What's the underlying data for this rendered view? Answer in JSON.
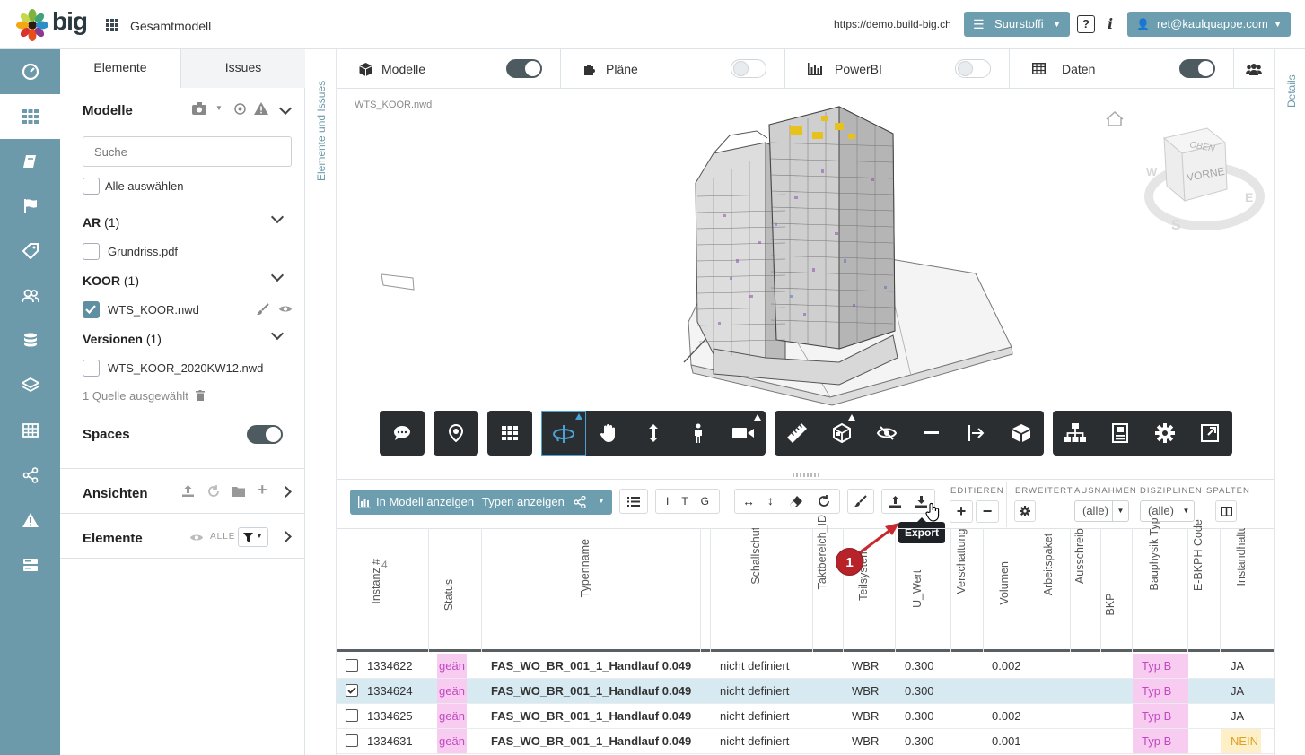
{
  "topbar": {
    "logo_text": "big",
    "project_name": "Gesamtmodell",
    "url": "https://demo.build-big.ch",
    "company_button": "Suurstoffi",
    "help_label": "?",
    "info_label": "i",
    "user_button": "ret@kaulquappe.com"
  },
  "left_panel": {
    "tab_elements": "Elemente",
    "tab_issues": "Issues",
    "models_header": "Modelle",
    "search_placeholder": "Suche",
    "select_all": "Alle auswählen",
    "groups": [
      {
        "name": "AR",
        "count": "(1)",
        "files": [
          {
            "name": "Grundriss.pdf",
            "checked": false
          }
        ]
      },
      {
        "name": "KOOR",
        "count": "(1)",
        "files": [
          {
            "name": "WTS_KOOR.nwd",
            "checked": true
          }
        ]
      },
      {
        "name": "Versionen",
        "count": "(1)",
        "files": [
          {
            "name": "WTS_KOOR_2020KW12.nwd",
            "checked": false
          }
        ]
      }
    ],
    "source_count": "1 Quelle ausgewählt",
    "spaces_label": "Spaces",
    "views_header": "Ansichten",
    "elements_header": "Elemente",
    "elements_filter": "ALLE"
  },
  "vertical_labels": {
    "left": "Elemente und Issues",
    "right": "Details"
  },
  "view_tabs": [
    {
      "label": "Modelle",
      "on": true
    },
    {
      "label": "Pläne",
      "on": false
    },
    {
      "label": "PowerBI",
      "on": false
    },
    {
      "label": "Daten",
      "on": true
    }
  ],
  "viewer": {
    "model_name": "WTS_KOOR.nwd",
    "cube_top": "OBEN",
    "cube_front": "VORNE",
    "compass": [
      "W",
      "S",
      "E"
    ]
  },
  "bottom_toolbar": {
    "show_in_model": "In Modell anzeigen",
    "show_types": "Typen anzeigen",
    "itg": [
      "I",
      "T",
      "G"
    ],
    "group_labels": [
      "EDITIEREN",
      "ERWEITERT",
      "AUSNAHMEN",
      "DISZIPLINEN",
      "SPALTEN"
    ],
    "exceptions_value": "(alle)",
    "disciplines_value": "(alle)",
    "tooltip": "Export",
    "callout_number": "1"
  },
  "table": {
    "count_label": "4",
    "columns": [
      "Instanz #",
      "Status",
      "Typenname",
      "Schallschutzanfo",
      "Taktbereich_ID",
      "Teilsystem",
      "U_Wert",
      "Verschattung",
      "Volumen",
      "Arbeitspaket",
      "Ausschreibungsp",
      "BKP",
      "Bauphysik Typ",
      "E-BKPH Code",
      "Instandhaltungsi"
    ],
    "rows": [
      {
        "checked": false,
        "instance": "1334622",
        "status": "geän",
        "type_name": "FAS_WO_BR_001_1_Handlauf 0.049",
        "sound": "nicht definiert",
        "subsystem": "WBR",
        "u_value": "0.300",
        "volume": "0.002",
        "bauphysik": "Typ B",
        "instand": "JA"
      },
      {
        "checked": true,
        "instance": "1334624",
        "status": "geän",
        "type_name": "FAS_WO_BR_001_1_Handlauf 0.049",
        "sound": "nicht definiert",
        "subsystem": "WBR",
        "u_value": "0.300",
        "volume": "",
        "bauphysik": "Typ B",
        "instand": "JA"
      },
      {
        "checked": false,
        "instance": "1334625",
        "status": "geän",
        "type_name": "FAS_WO_BR_001_1_Handlauf 0.049",
        "sound": "nicht definiert",
        "subsystem": "WBR",
        "u_value": "0.300",
        "volume": "0.002",
        "bauphysik": "Typ B",
        "instand": "JA"
      },
      {
        "checked": false,
        "instance": "1334631",
        "status": "geän",
        "type_name": "FAS_WO_BR_001_1_Handlauf 0.049",
        "sound": "nicht definiert",
        "subsystem": "WBR",
        "u_value": "0.300",
        "volume": "0.001",
        "bauphysik": "Typ B",
        "instand": "NEIN"
      }
    ]
  },
  "colors": {
    "accent": "#6d9aaa",
    "teal_button": "#6c9eaf",
    "dark_toolbar": "#2a2e31",
    "highlight_row": "#d7e9f1",
    "pink": "#f8ccf0",
    "callout_red": "#b8232a"
  }
}
